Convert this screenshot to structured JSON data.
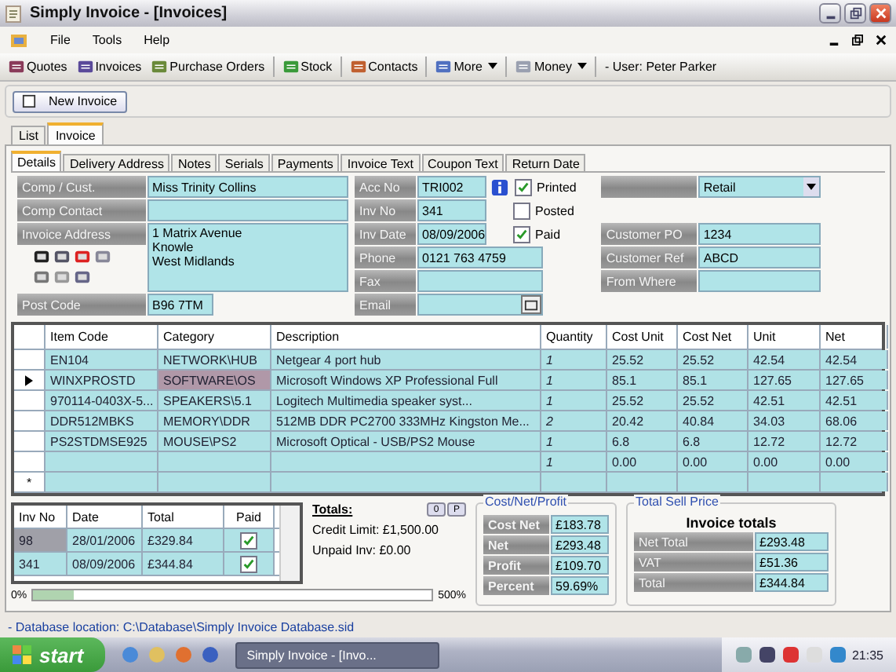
{
  "window": {
    "title": "Simply Invoice - [Invoices]"
  },
  "menu": [
    "File",
    "Tools",
    "Help"
  ],
  "toolbar": {
    "items": [
      {
        "label": "Quotes",
        "dropdown": false
      },
      {
        "label": "Invoices",
        "dropdown": false
      },
      {
        "label": "Purchase Orders",
        "dropdown": false
      },
      {
        "label": "Stock",
        "dropdown": false
      },
      {
        "label": "Contacts",
        "dropdown": false
      },
      {
        "label": "More",
        "dropdown": true
      },
      {
        "label": "Money",
        "dropdown": true
      }
    ],
    "user": "- User: Peter Parker"
  },
  "new_invoice_button": "New Invoice",
  "outer_tabs": [
    {
      "label": "List",
      "selected": false
    },
    {
      "label": "Invoice",
      "selected": true
    }
  ],
  "inner_tabs": [
    {
      "label": "Details",
      "selected": true
    },
    {
      "label": "Delivery Address",
      "selected": false
    },
    {
      "label": "Notes",
      "selected": false
    },
    {
      "label": "Serials",
      "selected": false
    },
    {
      "label": "Payments",
      "selected": false
    },
    {
      "label": "Invoice Text",
      "selected": false
    },
    {
      "label": "Coupon Text",
      "selected": false
    },
    {
      "label": "Return Date",
      "selected": false
    }
  ],
  "customer": {
    "name_label": "Comp / Cust.",
    "name": "Miss Trinity Collins",
    "contact_label": "Comp Contact",
    "address_label": "Invoice Address",
    "address_lines": [
      "1 Matrix Avenue",
      "Knowle",
      "West Midlands"
    ],
    "postcode_label": "Post Code",
    "postcode": "B96 7TM"
  },
  "details": [
    {
      "label": "Acc No",
      "value": "TRI002"
    },
    {
      "label": "Inv No",
      "value": "341"
    },
    {
      "label": "Inv Date",
      "value": "08/09/2006"
    },
    {
      "label": "Phone",
      "value": "0121 763 4759"
    },
    {
      "label": "Fax"
    },
    {
      "label": "Email"
    }
  ],
  "flags": [
    {
      "label": "Printed",
      "checked": true
    },
    {
      "label": "Posted",
      "checked": false
    },
    {
      "label": "Paid",
      "checked": true
    }
  ],
  "sale_type": "Retail",
  "references": [
    {
      "label": "Customer PO",
      "value": "1234"
    },
    {
      "label": "Customer Ref",
      "value": "ABCD"
    },
    {
      "label": "From Where"
    }
  ],
  "lines": {
    "columns": [
      "Item Code",
      "Category",
      "Description",
      "Quantity",
      "Cost Unit",
      "Cost Net",
      "Unit",
      "Net"
    ],
    "rows": [
      {
        "selected": false,
        "cells": [
          "EN104",
          "NETWORK\\HUB",
          "Netgear 4 port hub",
          "1",
          "25.52",
          "25.52",
          "42.54",
          "42.54"
        ]
      },
      {
        "selected": true,
        "cells": [
          "WINXPROSTD",
          "SOFTWARE\\OS",
          "Microsoft Windows XP Professional Full",
          "1",
          "85.1",
          "85.1",
          "127.65",
          "127.65"
        ]
      },
      {
        "selected": false,
        "cells": [
          "970114-0403X-5...",
          "SPEAKERS\\5.1",
          "Logitech Multimedia speaker syst...",
          "1",
          "25.52",
          "25.52",
          "42.51",
          "42.51"
        ]
      },
      {
        "selected": false,
        "cells": [
          "DDR512MBKS",
          "MEMORY\\DDR",
          "512MB DDR PC2700 333MHz Kingston Me...",
          "2",
          "20.42",
          "40.84",
          "34.03",
          "68.06"
        ]
      },
      {
        "selected": false,
        "cells": [
          "PS2STDMSE925",
          "MOUSE\\PS2",
          "Microsoft Optical - USB/PS2 Mouse",
          "1",
          "6.8",
          "6.8",
          "12.72",
          "12.72"
        ]
      },
      {
        "selected": false,
        "cells": [
          "",
          "",
          "",
          "1",
          "0.00",
          "0.00",
          "0.00",
          "0.00"
        ]
      }
    ],
    "new_row_marker": "*"
  },
  "history": {
    "columns": [
      "Inv No",
      "Date",
      "Total",
      "Paid"
    ],
    "rows": [
      {
        "selected": true,
        "inv_no": "98",
        "date": "28/01/2006",
        "total": "£329.84",
        "paid": true
      },
      {
        "selected": false,
        "inv_no": "341",
        "date": "08/09/2006",
        "total": "£344.84",
        "paid": true
      }
    ]
  },
  "totals": {
    "title": "Totals:",
    "credit_limit": "Credit Limit: £1,500.00",
    "unpaid": "Unpaid Inv: £0.00",
    "buttons": [
      "0",
      "P"
    ]
  },
  "progress": {
    "min": "0%",
    "max": "500%",
    "level": 0.1
  },
  "cost_net_profit": {
    "title": "Cost/Net/Profit",
    "rows": [
      {
        "label": "Cost Net",
        "value": "£183.78"
      },
      {
        "label": "Net",
        "value": "£293.48"
      },
      {
        "label": "Profit",
        "value": "£109.70"
      },
      {
        "label": "Percent",
        "value": "59.69%"
      }
    ]
  },
  "total_sell_price": {
    "title": "Total Sell Price",
    "heading": "Invoice totals",
    "rows": [
      {
        "label": "Net Total",
        "value": "£293.48"
      },
      {
        "label": "VAT",
        "value": "£51.36"
      },
      {
        "label": "Total",
        "value": "£344.84"
      }
    ]
  },
  "status_bar": "- Database location: C:\\Database\\Simply Invoice Database.sid",
  "taskbar": {
    "start": "start",
    "task": "Simply Invoice - [Invo...",
    "clock": "21:35"
  }
}
